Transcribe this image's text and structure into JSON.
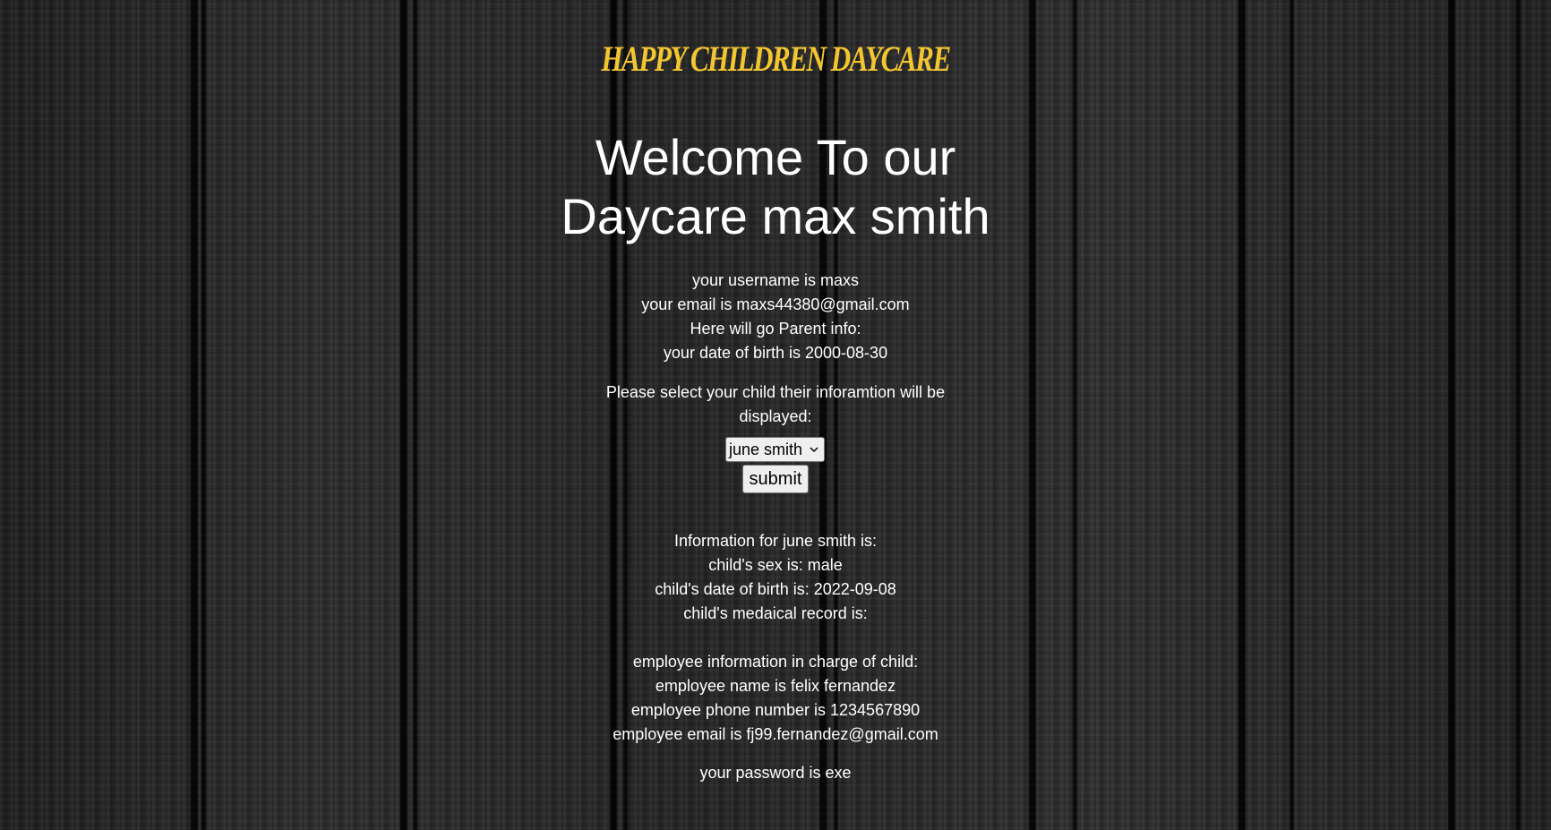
{
  "brand": "HAPPY CHILDREN DAYCARE",
  "welcome": {
    "line1": "Welcome To our",
    "line2": "Daycare max smith"
  },
  "parent": {
    "username": "your username is maxs",
    "email": "your email is maxs44380@gmail.com",
    "info_header": "Here will go Parent info:",
    "dob": "your date of birth is 2000-08-30"
  },
  "select_prompt": "Please select your child their inforamtion will be displayed:",
  "child_select": {
    "selected": "june smith"
  },
  "submit_label": "submit",
  "child": {
    "header": "Information for june smith is:",
    "sex": "child's sex is: male",
    "dob": "child's date of birth is: 2022-09-08",
    "medical": "child's medaical record is:"
  },
  "employee": {
    "header": "employee information in charge of child:",
    "name": "employee name is felix fernandez",
    "phone": "employee phone number is 1234567890",
    "email": "employee email is fj99.fernandez@gmail.com"
  },
  "password": "your password is exe",
  "colors": {
    "brand": "#f2c531",
    "text": "#ffffff",
    "background": "#2a2a2a"
  },
  "icons": {
    "select_arrow": "chevron-down-icon"
  }
}
